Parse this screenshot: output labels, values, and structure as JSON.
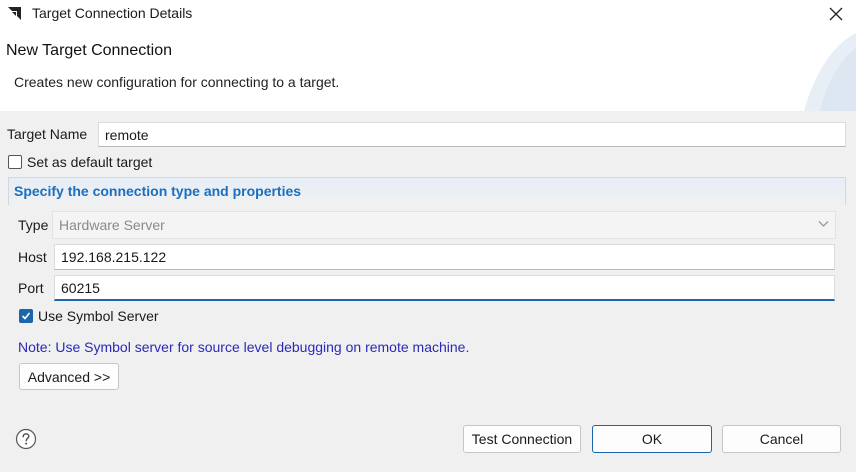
{
  "window": {
    "title": "Target Connection Details",
    "logo_icon": "amd-logo-icon",
    "close_icon": "close-icon"
  },
  "header": {
    "title": "New Target Connection",
    "description": "Creates new configuration for connecting to a target."
  },
  "target_name": {
    "label": "Target Name",
    "value": "remote"
  },
  "default_target": {
    "label": "Set as default target",
    "checked": false
  },
  "connection": {
    "section_title": "Specify the connection type and properties",
    "type_label": "Type",
    "type_value": "Hardware Server",
    "host_label": "Host",
    "host_value": "192.168.215.122",
    "port_label": "Port",
    "port_value": "60215",
    "symbol_server_label": "Use Symbol Server",
    "symbol_server_checked": true,
    "note": "Note: Use Symbol server for source level debugging on remote machine.",
    "advanced_label": "Advanced >>"
  },
  "footer": {
    "help_icon": "help-icon",
    "test_label": "Test Connection",
    "ok_label": "OK",
    "cancel_label": "Cancel"
  },
  "colors": {
    "accent": "#1b65ac",
    "section_title": "#1b6fbf",
    "note": "#2a2ab8",
    "dialog_bg": "#f0f0f0"
  }
}
